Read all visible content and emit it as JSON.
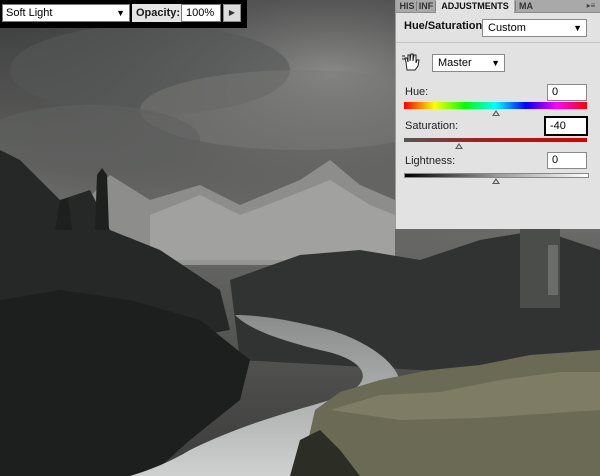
{
  "layer_bar": {
    "blend_mode": "Soft Light",
    "opacity_label": "Opacity:",
    "opacity_value": "100%"
  },
  "panel": {
    "tabs": [
      {
        "label": "HIS"
      },
      {
        "label": "INF"
      },
      {
        "label": "ADJUSTMENTS"
      },
      {
        "label": "MA"
      }
    ],
    "title": "Hue/Saturation",
    "preset": "Custom",
    "channel": "Master",
    "hue": {
      "label": "Hue:",
      "value": "0",
      "level": 0.5
    },
    "saturation": {
      "label": "Saturation:",
      "value": "-40",
      "level": 0.3
    },
    "lightness": {
      "label": "Lightness:",
      "value": "0",
      "level": 0.5
    }
  },
  "icons": {
    "hand": "targeted-adjustment-hand-icon",
    "dropdown": "chevron-down-icon",
    "stepper": "triangle-right-icon",
    "panel_menu": "panel-menu-icon"
  },
  "colors": {
    "panel_bg": "#e2e2e2",
    "tab_bar": "#a9a9a9",
    "highlight_border": "#000000"
  }
}
